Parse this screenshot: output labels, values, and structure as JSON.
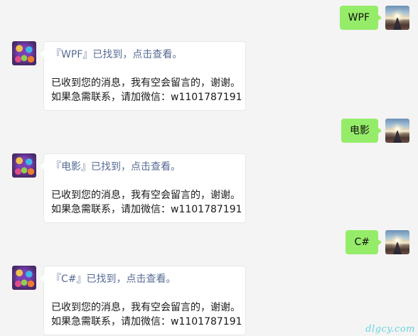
{
  "messages": [
    {
      "sent": "WPF",
      "reply_link": "『WPF』已找到，点击查看。",
      "reply_line1": "已收到您的消息，我有空会留言的，谢谢。",
      "reply_line2": "如果急需联系，请加微信：w1101787191"
    },
    {
      "sent": "电影",
      "reply_link": "『电影』已找到，点击查看。",
      "reply_line1": "已收到您的消息，我有空会留言的，谢谢。",
      "reply_line2": "如果急需联系，请加微信：w1101787191"
    },
    {
      "sent": "C#",
      "reply_link": "『C#』已找到，点击查看。",
      "reply_line1": "已收到您的消息，我有空会留言的，谢谢。",
      "reply_line2": "如果急需联系，请加微信：w1101787191"
    }
  ],
  "watermark": "dlgcy.com",
  "colors": {
    "background": "#f4f4f4",
    "sent_bubble": "#95ec69",
    "link": "#576b95"
  }
}
